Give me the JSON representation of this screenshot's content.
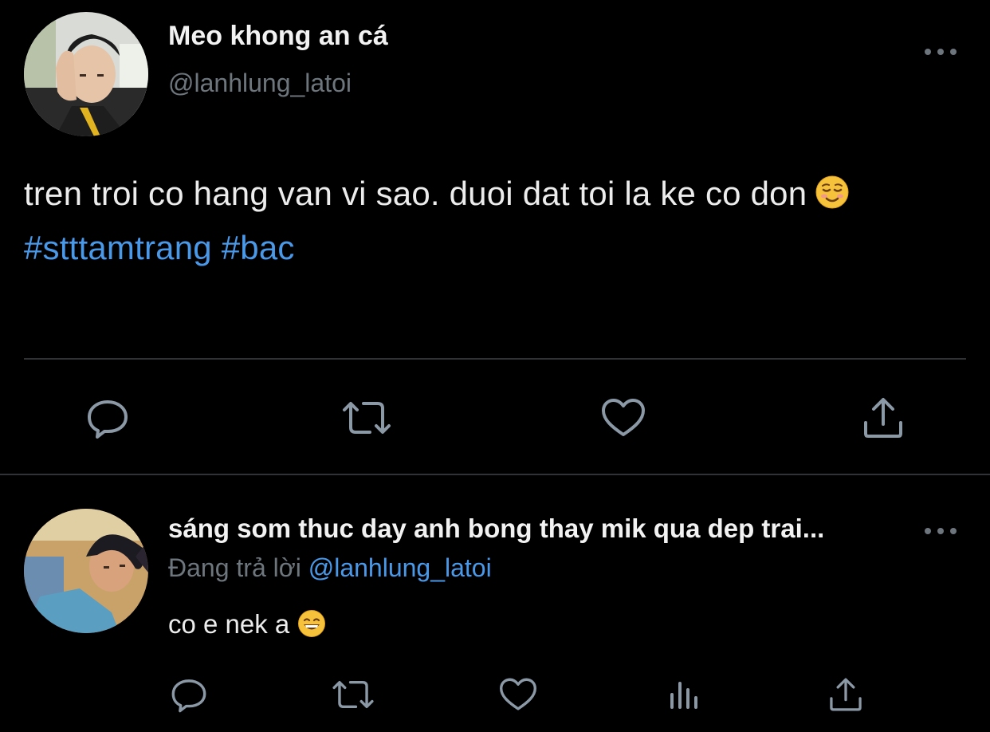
{
  "main_tweet": {
    "display_name": "Meo khong an cá",
    "handle": "@lanhlung_latoi",
    "text": "tren troi co hang van vi sao. duoi dat toi la ke co don",
    "hashtags": [
      "#stttamtrang",
      "#bac"
    ],
    "actions": [
      "reply-icon",
      "retweet-icon",
      "like-icon",
      "share-icon"
    ]
  },
  "reply_tweet": {
    "display_name": "sáng som thuc day anh bong thay mik qua dep trai...",
    "replying_to_prefix": "Đang trả lời",
    "replying_to_handle": "@lanhlung_latoi",
    "text": "co e nek a",
    "actions": [
      "reply-icon",
      "retweet-icon",
      "like-icon",
      "analytics-icon",
      "share-icon"
    ]
  },
  "colors": {
    "background": "#000000",
    "text": "#ececec",
    "secondary": "#6e767d",
    "link": "#4a99e9",
    "divider": "#2f3336"
  }
}
